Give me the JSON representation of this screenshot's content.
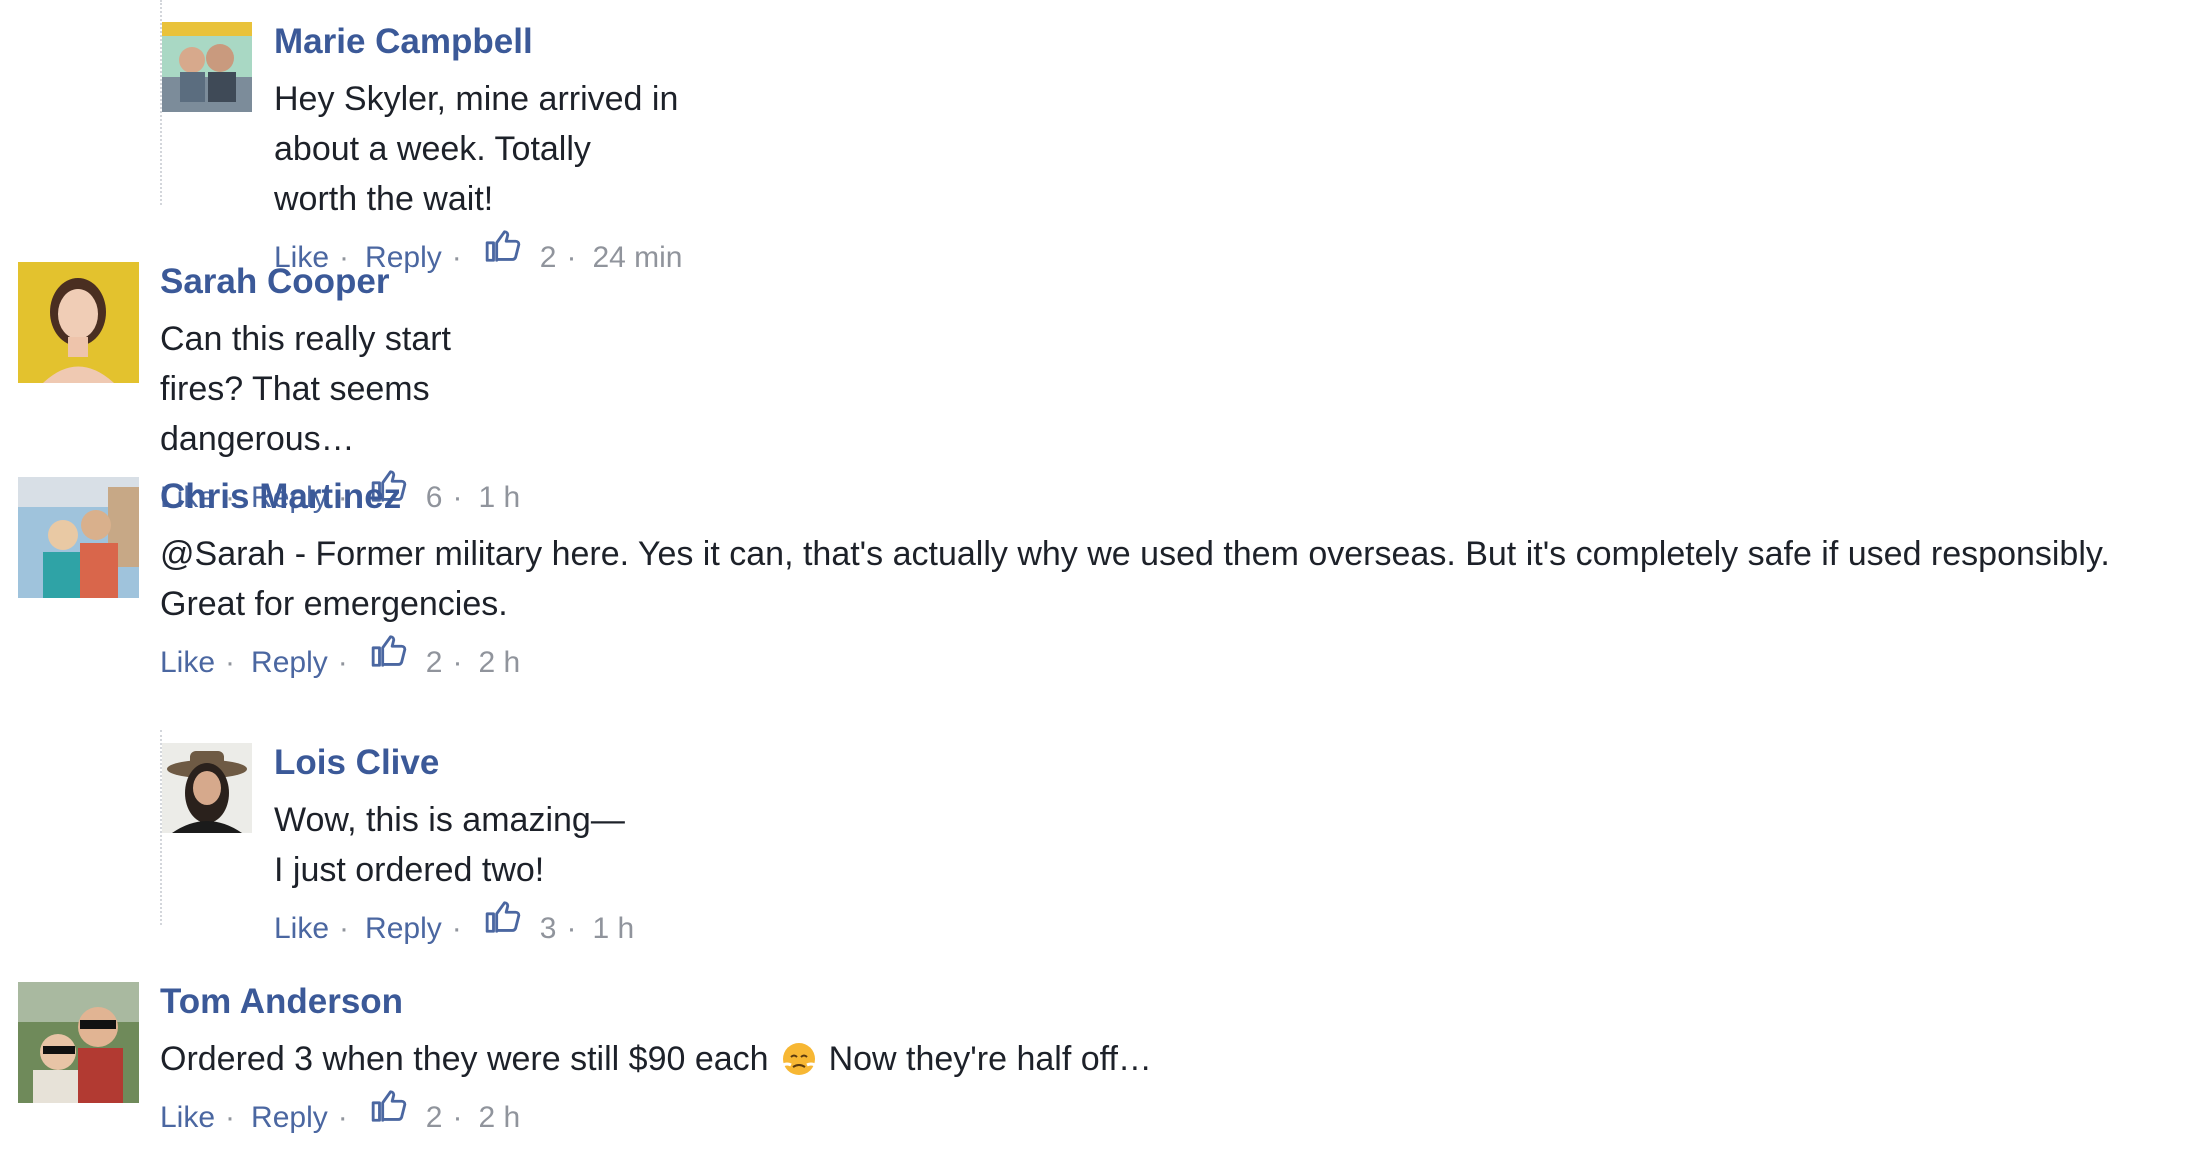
{
  "comments": [
    {
      "name": "Marie Campbell",
      "text": "Hey Skyler, mine arrived in about a week. Totally worth the wait!",
      "like": "Like",
      "reply": "Reply",
      "likes": "2",
      "time": "24 min"
    },
    {
      "name": "Sarah Cooper",
      "text": "Can this really start fires? That seems dangerous…",
      "like": "Like",
      "reply": "Reply",
      "likes": "6",
      "time": "1 h"
    },
    {
      "name": "Chris Martinez",
      "text1": "@Sarah - Former military here. Yes it can, that's actually why we used them overseas. But it's completely safe if used responsibly.",
      "text2": "Great for emergencies.",
      "like": "Like",
      "reply": "Reply",
      "likes": "2",
      "time": "2 h"
    },
    {
      "name": "Lois Clive",
      "text": "Wow, this is amazing—I just ordered two!",
      "like": "Like",
      "reply": "Reply",
      "likes": "3",
      "time": "1 h"
    },
    {
      "name": "Tom Anderson",
      "text_before": "Ordered 3 when they were still $90 each",
      "text_after": "Now they're half off…",
      "emoji": "steaming-face-emoji",
      "like": "Like",
      "reply": "Reply",
      "likes": "2",
      "time": "2 h"
    }
  ],
  "colors": {
    "name": "#3b5998",
    "link": "#4b67a1",
    "meta": "#90949c",
    "text": "#1d2129"
  }
}
